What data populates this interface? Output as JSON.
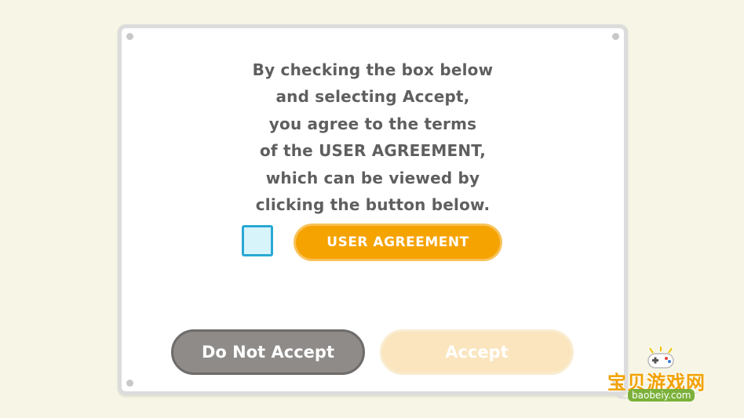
{
  "dialog": {
    "message_lines": [
      "By checking the box below",
      "and selecting Accept,",
      "you agree to the terms",
      "of the USER AGREEMENT,",
      "which can be viewed by",
      "clicking the button below."
    ],
    "agreement_button_label": "USER AGREEMENT",
    "checkbox_checked": false,
    "decline_button_label": "Do Not Accept",
    "accept_button_label": "Accept",
    "accept_enabled": false
  },
  "watermark": {
    "chinese_text": "宝贝游戏网",
    "url_text": "baobeiy.com",
    "icon": "gamepad-icon"
  },
  "colors": {
    "background": "#f7f6e6",
    "text": "#5f5f5f",
    "agreement_button": "#f5a300",
    "checkbox_border": "#29a8d4",
    "decline_button": "#8e8b89",
    "accept_button_disabled": "#fae5bf"
  }
}
